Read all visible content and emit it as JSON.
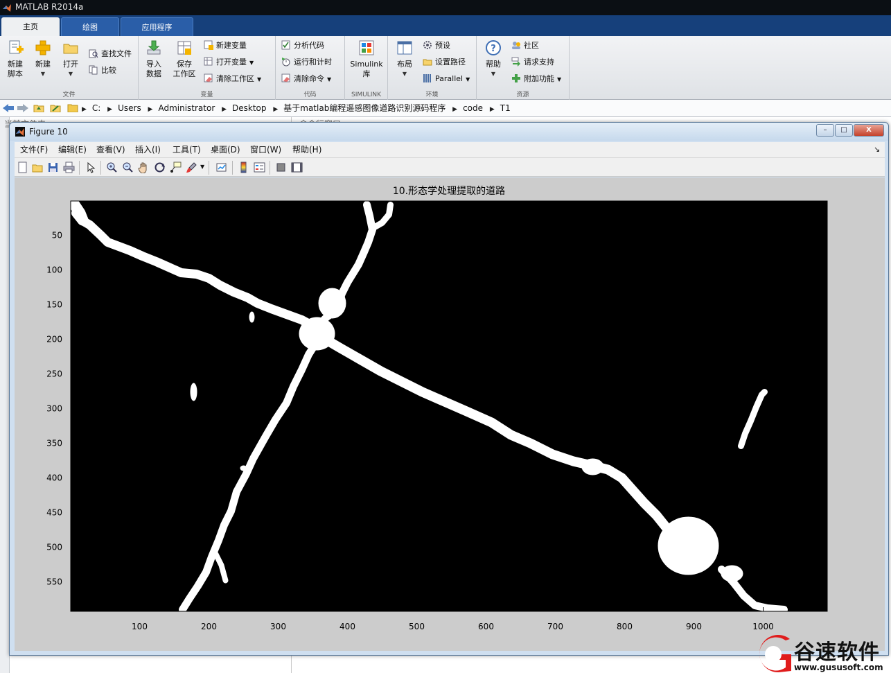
{
  "app": {
    "title": "MATLAB R2014a"
  },
  "ribbon": {
    "tabs": [
      {
        "label": "主页",
        "active": true
      },
      {
        "label": "绘图",
        "active": false
      },
      {
        "label": "应用程序",
        "active": false
      }
    ],
    "groups": {
      "file": {
        "label": "文件",
        "new_script": "新建\n脚本",
        "new": "新建",
        "open": "打开",
        "find_files": "查找文件",
        "compare": "比较"
      },
      "variable": {
        "label": "变量",
        "import": "导入\n数据",
        "save": "保存\n工作区",
        "new_variable": "新建变量",
        "open_variable": "打开变量",
        "clear_workspace": "清除工作区"
      },
      "code": {
        "label": "代码",
        "analyze": "分析代码",
        "run_time": "运行和计时",
        "clear_commands": "清除命令"
      },
      "simulink": {
        "label": "SIMULINK",
        "library": "Simulink\n库"
      },
      "environment": {
        "label": "环境",
        "layout": "布局",
        "preferences": "预设",
        "set_path": "设置路径",
        "parallel": "Parallel"
      },
      "resources": {
        "label": "资源",
        "help": "帮助",
        "community": "社区",
        "support": "请求支持",
        "addons": "附加功能"
      }
    }
  },
  "address": {
    "segments": [
      "C:",
      "Users",
      "Administrator",
      "Desktop",
      "基于matlab编程遥感图像道路识别源码程序",
      "code",
      "T1"
    ]
  },
  "background": {
    "current_folder_label": "当前文件夹",
    "command_window_label": "命令行窗口"
  },
  "figure": {
    "window_title": "Figure 10",
    "window_buttons": {
      "minimize": "–",
      "maximize": "□",
      "close": "X"
    },
    "menu": [
      "文件(F)",
      "编辑(E)",
      "查看(V)",
      "插入(I)",
      "工具(T)",
      "桌面(D)",
      "窗口(W)",
      "帮助(H)"
    ],
    "dock_arrow": "↘",
    "toolbar_icons": [
      "new-figure-icon",
      "open-file-icon",
      "save-icon",
      "print-icon",
      "pointer-icon",
      "zoom-in-icon",
      "zoom-out-icon",
      "pan-hand-icon",
      "rotate-3d-icon",
      "data-cursor-icon",
      "brush-icon",
      "link-plot-icon",
      "colorbar-icon",
      "legend-icon",
      "hide-plot-tools-icon",
      "show-plot-tools-icon"
    ]
  },
  "chart_data": {
    "type": "image",
    "title": "10.形态学处理提取的道路",
    "xlim": [
      0.5,
      1092.5
    ],
    "ylim": [
      0.5,
      592.5
    ],
    "y_reversed": true,
    "xticks": [
      100,
      200,
      300,
      400,
      500,
      600,
      700,
      800,
      900,
      1000
    ],
    "yticks": [
      50,
      100,
      150,
      200,
      250,
      300,
      350,
      400,
      450,
      500,
      550
    ],
    "colormap": {
      "background": "#000000",
      "foreground": "#ffffff"
    },
    "road_paths": [
      {
        "name": "northwest-road",
        "width": 13,
        "points": [
          [
            8,
            18
          ],
          [
            16,
            28
          ],
          [
            28,
            35
          ],
          [
            44,
            50
          ],
          [
            54,
            60
          ],
          [
            70,
            66
          ],
          [
            86,
            72
          ],
          [
            104,
            80
          ],
          [
            124,
            88
          ],
          [
            142,
            96
          ],
          [
            160,
            104
          ],
          [
            182,
            106
          ],
          [
            200,
            112
          ],
          [
            216,
            122
          ],
          [
            236,
            132
          ],
          [
            256,
            140
          ],
          [
            270,
            148
          ],
          [
            290,
            156
          ],
          [
            312,
            164
          ],
          [
            334,
            172
          ],
          [
            356,
            184
          ]
        ]
      },
      {
        "name": "north-road",
        "width": 11,
        "points": [
          [
            352,
            186
          ],
          [
            370,
            168
          ],
          [
            384,
            158
          ],
          [
            392,
            134
          ],
          [
            400,
            118
          ],
          [
            416,
            92
          ],
          [
            424,
            74
          ],
          [
            430,
            60
          ],
          [
            436,
            42
          ],
          [
            432,
            22
          ],
          [
            428,
            6
          ]
        ]
      },
      {
        "name": "southwest-road",
        "width": 11,
        "points": [
          [
            358,
            200
          ],
          [
            344,
            222
          ],
          [
            334,
            244
          ],
          [
            322,
            268
          ],
          [
            312,
            292
          ],
          [
            296,
            316
          ],
          [
            282,
            340
          ],
          [
            264,
            372
          ],
          [
            254,
            394
          ],
          [
            240,
            420
          ],
          [
            232,
            448
          ],
          [
            222,
            468
          ],
          [
            214,
            490
          ],
          [
            204,
            514
          ],
          [
            196,
            536
          ],
          [
            184,
            556
          ],
          [
            172,
            574
          ],
          [
            162,
            590
          ]
        ]
      },
      {
        "name": "southeast-road",
        "width": 14,
        "points": [
          [
            368,
            200
          ],
          [
            392,
            214
          ],
          [
            420,
            230
          ],
          [
            448,
            246
          ],
          [
            476,
            260
          ],
          [
            508,
            276
          ],
          [
            540,
            290
          ],
          [
            572,
            304
          ],
          [
            608,
            320
          ],
          [
            636,
            338
          ],
          [
            664,
            350
          ],
          [
            696,
            366
          ],
          [
            726,
            376
          ],
          [
            752,
            382
          ],
          [
            776,
            388
          ],
          [
            796,
            400
          ],
          [
            812,
            418
          ],
          [
            828,
            436
          ],
          [
            846,
            454
          ],
          [
            862,
            474
          ]
        ]
      },
      {
        "name": "east-road",
        "width": 11,
        "points": [
          [
            940,
            532
          ],
          [
            958,
            552
          ],
          [
            972,
            570
          ],
          [
            988,
            584
          ],
          [
            1006,
            588
          ],
          [
            1030,
            590
          ]
        ]
      },
      {
        "name": "northeast-fragment",
        "width": 9,
        "points": [
          [
            968,
            354
          ],
          [
            974,
            336
          ],
          [
            982,
            318
          ],
          [
            990,
            298
          ],
          [
            998,
            280
          ],
          [
            1002,
            276
          ]
        ]
      },
      {
        "name": "north-fork",
        "width": 9,
        "points": [
          [
            436,
            40
          ],
          [
            450,
            32
          ],
          [
            460,
            20
          ],
          [
            462,
            6
          ]
        ]
      },
      {
        "name": "northwest-corner",
        "width": 16,
        "points": [
          [
            6,
            6
          ],
          [
            14,
            18
          ],
          [
            18,
            28
          ]
        ]
      },
      {
        "name": "road-stub-south",
        "width": 8,
        "points": [
          [
            210,
            510
          ],
          [
            218,
            526
          ],
          [
            224,
            548
          ]
        ]
      }
    ],
    "blobs": [
      {
        "name": "junction-blob",
        "cx": 356,
        "cy": 192,
        "rx": 26,
        "ry": 24
      },
      {
        "name": "north-junction-blob",
        "cx": 378,
        "cy": 148,
        "rx": 20,
        "ry": 22
      },
      {
        "name": "southeast-blob",
        "cx": 892,
        "cy": 498,
        "rx": 44,
        "ry": 42
      },
      {
        "name": "east-small-blob",
        "cx": 955,
        "cy": 538,
        "rx": 16,
        "ry": 12
      },
      {
        "name": "east-mid-blob",
        "cx": 754,
        "cy": 384,
        "rx": 16,
        "ry": 12
      },
      {
        "name": "isolated-speck",
        "cx": 178,
        "cy": 276,
        "rx": 5,
        "ry": 13
      },
      {
        "name": "west-stub",
        "cx": 250,
        "cy": 386,
        "rx": 5,
        "ry": 4
      },
      {
        "name": "northwest-stub",
        "cx": 262,
        "cy": 168,
        "rx": 4,
        "ry": 8
      }
    ]
  }
}
